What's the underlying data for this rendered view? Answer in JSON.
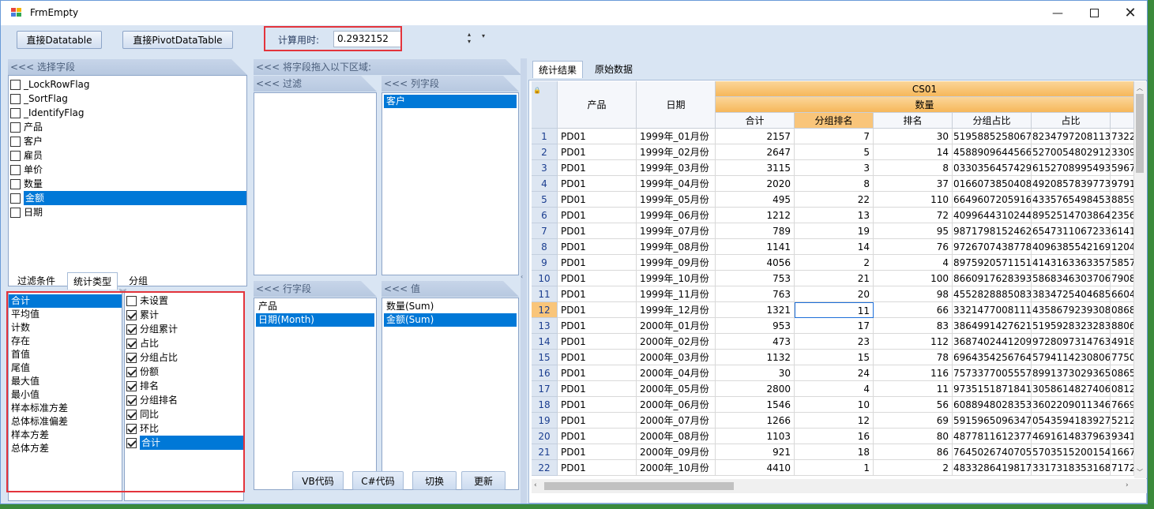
{
  "window": {
    "title": "FrmEmpty"
  },
  "toolbar": {
    "btn_datatable": "直接Datatable",
    "btn_pivot": "直接PivotDataTable",
    "time_label": "计算用时:",
    "time_value": "0.2932152"
  },
  "field_panel": {
    "header": "<<< 选择字段",
    "fields": [
      {
        "label": "_LockRowFlag",
        "checked": false
      },
      {
        "label": "_SortFlag",
        "checked": false
      },
      {
        "label": "_IdentifyFlag",
        "checked": false
      },
      {
        "label": "产品",
        "checked": false
      },
      {
        "label": "客户",
        "checked": false
      },
      {
        "label": "雇员",
        "checked": false
      },
      {
        "label": "单价",
        "checked": false
      },
      {
        "label": "数量",
        "checked": false
      },
      {
        "label": "金额",
        "checked": false,
        "selected": true
      },
      {
        "label": "日期",
        "checked": false
      }
    ]
  },
  "left_tabs": [
    "过滤条件",
    "统计类型",
    "分组"
  ],
  "stat_types": [
    "合计",
    "平均值",
    "计数",
    "存在",
    "首值",
    "尾值",
    "最大值",
    "最小值",
    "样本标准方差",
    "总体标准偏差",
    "样本方差",
    "总体方差"
  ],
  "stat_options": [
    {
      "label": "未设置",
      "checked": false
    },
    {
      "label": "累计",
      "checked": true
    },
    {
      "label": "分组累计",
      "checked": true
    },
    {
      "label": "占比",
      "checked": true
    },
    {
      "label": "分组占比",
      "checked": true
    },
    {
      "label": "份额",
      "checked": true
    },
    {
      "label": "排名",
      "checked": true
    },
    {
      "label": "分组排名",
      "checked": true
    },
    {
      "label": "同比",
      "checked": true
    },
    {
      "label": "环比",
      "checked": true
    },
    {
      "label": "合计",
      "checked": true,
      "selected": true
    }
  ],
  "drag_area": {
    "header": "<<< 将字段拖入以下区域:",
    "filter_hdr": "<<< 过滤",
    "col_hdr": "<<< 列字段",
    "col_items": [
      "客户"
    ],
    "row_hdr": "<<< 行字段",
    "row_items": [
      "产品",
      "日期(Month)"
    ],
    "val_hdr": "<<< 值",
    "val_items": [
      "数量(Sum)",
      "金额(Sum)"
    ]
  },
  "bottom_buttons": [
    "VB代码",
    "C#代码",
    "切换",
    "更新"
  ],
  "result_tabs": [
    "统计结果",
    "原始数据"
  ],
  "grid": {
    "group_header": "CS01",
    "sub_header": "数量",
    "col_product": "产品",
    "col_date": "日期",
    "columns": [
      "合计",
      "分组排名",
      "排名",
      "分组占比",
      "占比"
    ],
    "rows": [
      [
        "1",
        "PD01",
        "1999年_01月份",
        "2157",
        "7",
        "30",
        "5195885258067",
        "8234797208113",
        "7322"
      ],
      [
        "2",
        "PD01",
        "1999年_02月份",
        "2647",
        "5",
        "14",
        "4588909644566",
        "5270054802912",
        "3309"
      ],
      [
        "3",
        "PD01",
        "1999年_03月份",
        "3115",
        "3",
        "8",
        "0330356457429",
        "6152708995493",
        "5967"
      ],
      [
        "4",
        "PD01",
        "1999年_04月份",
        "2020",
        "8",
        "37",
        "0166073850408",
        "4920857839773",
        "9791"
      ],
      [
        "5",
        "PD01",
        "1999年_05月份",
        "495",
        "22",
        "110",
        "6649607205916",
        "4335765498453",
        "8859"
      ],
      [
        "6",
        "PD01",
        "1999年_06月份",
        "1212",
        "13",
        "72",
        "4099644310244",
        "8952514703864",
        "2356"
      ],
      [
        "7",
        "PD01",
        "1999年_07月份",
        "789",
        "19",
        "95",
        "9871798152462",
        "6547311067233",
        "6141"
      ],
      [
        "8",
        "PD01",
        "1999年_08月份",
        "1141",
        "14",
        "76",
        "9726707438778",
        "4096385542169",
        "1204"
      ],
      [
        "9",
        "PD01",
        "1999年_09月份",
        "4056",
        "2",
        "4",
        "8975920571151",
        "4143163363357",
        "5857"
      ],
      [
        "10",
        "PD01",
        "1999年_10月份",
        "753",
        "21",
        "100",
        "8660917628393",
        "5868346303706",
        "7908"
      ],
      [
        "11",
        "PD01",
        "1999年_11月份",
        "763",
        "20",
        "98",
        "4552828885083",
        "3834725404685",
        "6604"
      ],
      [
        "12",
        "PD01",
        "1999年_12月份",
        "1321",
        "11",
        "66",
        "3321477008111",
        "4358679239308",
        "0868"
      ],
      [
        "13",
        "PD01",
        "2000年_01月份",
        "953",
        "17",
        "83",
        "3864991427621",
        "5195928323283",
        "8806"
      ],
      [
        "14",
        "PD01",
        "2000年_02月份",
        "473",
        "23",
        "112",
        "3687402441209",
        "9728097314763",
        "4918"
      ],
      [
        "15",
        "PD01",
        "2000年_03月份",
        "1132",
        "15",
        "78",
        "6964354256764",
        "5794114230806",
        "7750"
      ],
      [
        "16",
        "PD01",
        "2000年_04月份",
        "30",
        "24",
        "116",
        "7573377005557",
        "8991373029365",
        "0865"
      ],
      [
        "17",
        "PD01",
        "2000年_05月份",
        "2800",
        "4",
        "11",
        "9735151871841",
        "3058614827406",
        "0812"
      ],
      [
        "18",
        "PD01",
        "2000年_06月份",
        "1546",
        "10",
        "56",
        "6088948028353",
        "3602209011346",
        "7669"
      ],
      [
        "19",
        "PD01",
        "2000年_07月份",
        "1266",
        "12",
        "69",
        "5915965096347",
        "0543594183927",
        "5212"
      ],
      [
        "20",
        "PD01",
        "2000年_08月份",
        "1103",
        "16",
        "80",
        "4877811612377",
        "4691614837963",
        "9341"
      ],
      [
        "21",
        "PD01",
        "2000年_09月份",
        "921",
        "18",
        "86",
        "7645026740705",
        "5703515200154",
        "1667"
      ],
      [
        "22",
        "PD01",
        "2000年_10月份",
        "4410",
        "1",
        "2",
        "4833286419817",
        "3317318353168",
        "7172"
      ]
    ],
    "selected_row": 12
  },
  "colors": {
    "accent": "#0078d7",
    "header_orange": "#f9c57a",
    "highlight": "#e3343c"
  }
}
